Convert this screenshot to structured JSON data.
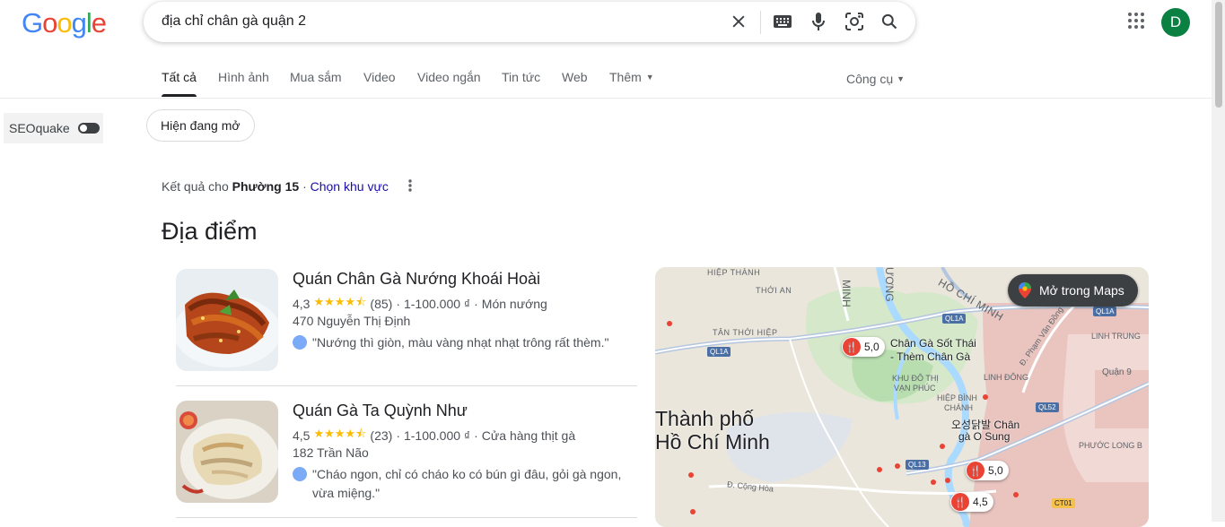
{
  "header": {
    "logo_text": "Google",
    "search_query": "địa chỉ chân gà quận 2",
    "avatar_initial": "D"
  },
  "tabs": [
    {
      "label": "Tất cả",
      "active": true
    },
    {
      "label": "Hình ảnh"
    },
    {
      "label": "Mua sắm"
    },
    {
      "label": "Video"
    },
    {
      "label": "Video ngắn"
    },
    {
      "label": "Tin tức"
    },
    {
      "label": "Web"
    },
    {
      "label": "Thêm"
    }
  ],
  "tools_label": "Công cụ",
  "seoquake_label": "SEOquake",
  "chip_label": "Hiện đang mở",
  "location": {
    "prefix": "Kết quả cho",
    "area": "Phường 15",
    "separator": "·",
    "change_link": "Chọn khu vực"
  },
  "section_title": "Địa điểm",
  "places": [
    {
      "name": "Quán Chân Gà Nướng Khoái Hoài",
      "rating": "4,3",
      "stars": "★★★★⯪",
      "reviews": "(85)",
      "price": "1-100.000 ₫",
      "category": "Món nướng",
      "address": "470 Nguyễn Thị Định",
      "review": "\"Nướng thì giòn, màu vàng nhạt nhạt trông rất thèm.\""
    },
    {
      "name": "Quán Gà Ta Quỳnh Như",
      "rating": "4,5",
      "stars": "★★★★⯪",
      "reviews": "(23)",
      "price": "1-100.000 ₫",
      "category": "Cửa hàng thịt gà",
      "address": "182 Trần Não",
      "review": "\"Cháo ngon, chỉ có cháo ko có bún gì đâu, gỏi gà ngon, vừa miệng.\""
    }
  ],
  "map": {
    "open_button": "Mở trong Maps",
    "labels": {
      "hiep_thanh": "HIỆP THÀNH",
      "thoi_an": "THỚI AN",
      "tan_thoi_hiep": "TÂN THỚI HIỆP",
      "city_line1": "Thành phố",
      "city_line2": "Hồ Chí Minh",
      "khu_do_thi": "KHU ĐÔ THỊ",
      "van_phuc": "VẠN PHÚC",
      "hiep_binh": "HIỆP BÌNH",
      "chanh": "CHÁNH",
      "linh_trung": "LINH TRUNG",
      "linh_dong": "LINH ĐÔNG",
      "phuoc_long": "PHƯỚC LONG B",
      "ho_chi_minh_road": "HỒ CHÍ MINH",
      "minh": "MINH",
      "duong": "ƯƠNG",
      "pham_van_dong": "Đ. Phạm Văn Đồng",
      "cong_hoa": "Đ. Cộng Hòa",
      "quan9": "Quận 9",
      "ql1a_1": "QL1A",
      "ql1a_2": "QL1A",
      "ql1a_3": "QL1A",
      "ql13": "QL13",
      "ql52": "QL52",
      "ct01": "CT01",
      "shop1_line1": "Chân Gà Sốt Thái",
      "shop1_line2": "- Thèm Chân Gà",
      "shop2_line1": "오성닭발 Chân",
      "shop2_line2": "gà O Sung",
      "pin1_rating": "5,0",
      "pin2_rating": "5,0",
      "pin3_rating": "4,5"
    }
  },
  "colors": {
    "link": "#1a0dab",
    "star": "#fbbc04",
    "pin": "#ea4335",
    "avatar_bg": "#0b8043"
  }
}
